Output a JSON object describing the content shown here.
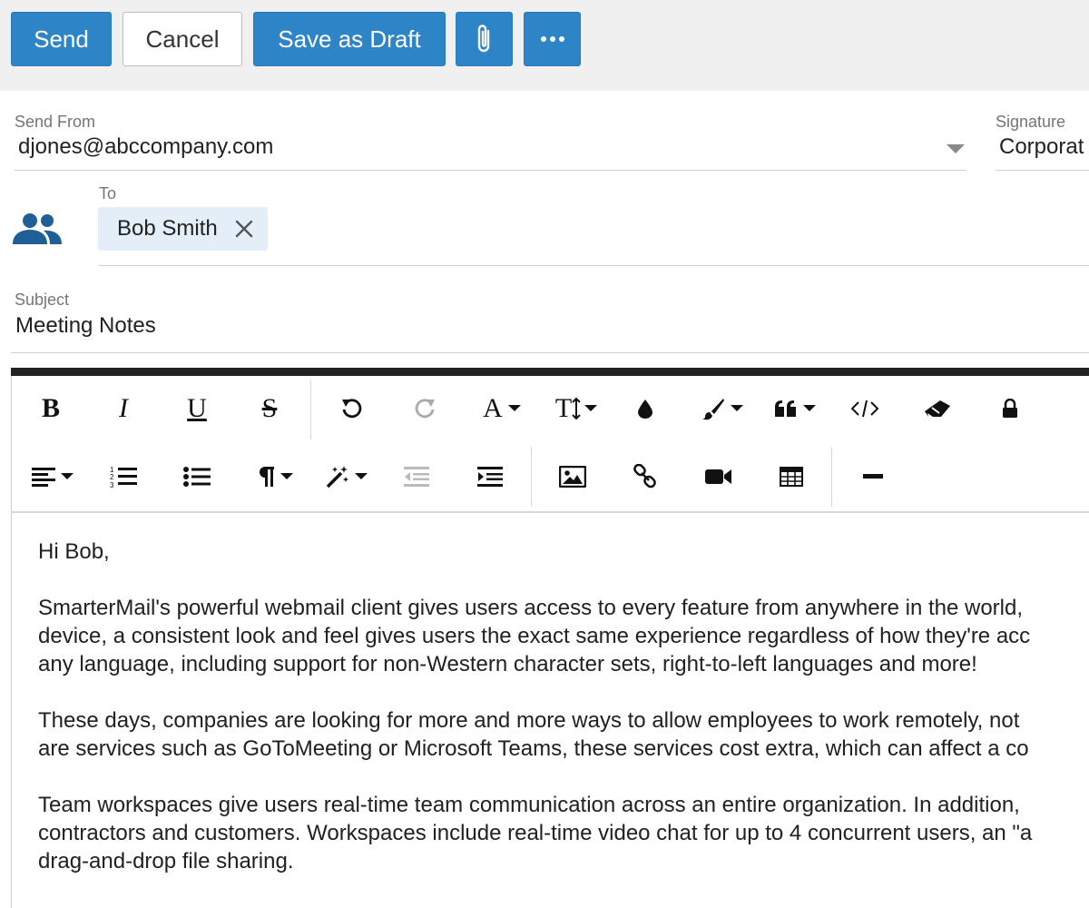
{
  "toolbar": {
    "send_label": "Send",
    "cancel_label": "Cancel",
    "draft_label": "Save as Draft",
    "attach_icon": "paperclip-icon",
    "more_icon": "ellipsis-icon",
    "accent_color": "#2d84c6"
  },
  "form": {
    "send_from_label": "Send From",
    "send_from_value": "djones@abccompany.com",
    "signature_label": "Signature",
    "signature_value": "Corporat",
    "to_label": "To",
    "recipients": [
      {
        "name": "Bob Smith"
      }
    ],
    "subject_label": "Subject",
    "subject_value": "Meeting Notes"
  },
  "editor": {
    "row1_tools": [
      "bold",
      "italic",
      "underline",
      "strikethrough",
      "undo",
      "redo",
      "font-family",
      "font-size",
      "text-color",
      "background-color",
      "quote",
      "code-view",
      "clear-formatting",
      "lock"
    ],
    "row2_tools": [
      "align",
      "ordered-list",
      "unordered-list",
      "paragraph-format",
      "magic-wand",
      "outdent",
      "indent",
      "insert-image",
      "insert-link",
      "insert-video",
      "insert-table",
      "horizontal-line"
    ],
    "font_letter": "A",
    "font_size_letters": "T",
    "body": {
      "greeting": "Hi Bob,",
      "p1": [
        "SmarterMail's powerful webmail client gives users access to every feature from anywhere in the world,",
        "device, a consistent look and feel gives users the exact same experience regardless of how they're acc",
        "any language, including support for non-Western character sets, right-to-left languages and more!"
      ],
      "p2": [
        "These days, companies are looking for more and more ways to allow employees to work remotely, not",
        "are services such as GoToMeeting or Microsoft Teams, these services cost extra, which can affect a co"
      ],
      "p3": [
        "Team workspaces give users real-time team communication across an entire organization. In addition,",
        "contractors and customers. Workspaces include real-time video chat for up to 4 concurrent users, an \"a",
        "drag-and-drop file sharing."
      ]
    }
  }
}
